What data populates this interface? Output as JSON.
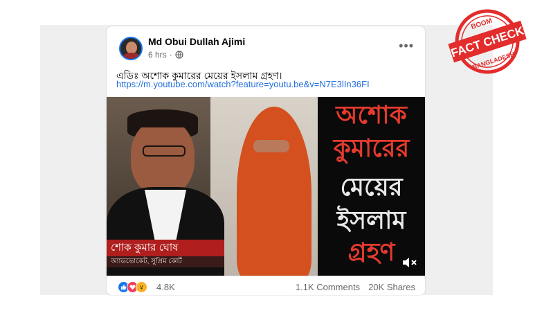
{
  "post": {
    "author": "Md Obui Dullah Ajimi",
    "time": "6 hrs",
    "text": "এডিঃ অশোক কুমারের মেয়ের ইসলাম গ্রহণ।",
    "link": "https://m.youtube.com/watch?feature=youtu.be&v=N7E3lIn36FI"
  },
  "video": {
    "title_lines": [
      "অশোক",
      "কুমারের",
      "মেয়ের",
      "ইসলাম",
      "গ্রহণ"
    ],
    "banner_text": "শোক কুমার ঘোষ",
    "subbanner_text": "অ্যাডভোকেট, সুপ্রিম কোর্ট"
  },
  "footer": {
    "reaction_count": "4.8K",
    "comments": "1.1K Comments",
    "shares": "20K Shares"
  },
  "stamp": {
    "top": "BOOM",
    "main": "FACT CHECK",
    "bottom": "BANGLADESH"
  },
  "icons": {
    "globe": "globe-icon",
    "more": "more-options-icon",
    "mute": "mute-icon"
  },
  "colors": {
    "link": "#216fdb",
    "stamp": "#e32c2c",
    "title_red": "#e53a2e"
  }
}
